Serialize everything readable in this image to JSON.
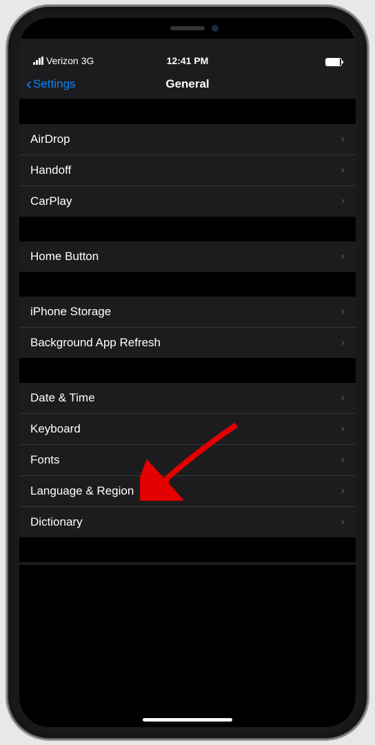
{
  "statusBar": {
    "carrier": "Verizon",
    "network": "3G",
    "time": "12:41 PM"
  },
  "navBar": {
    "backLabel": "Settings",
    "title": "General"
  },
  "groups": [
    {
      "items": [
        {
          "label": "AirDrop"
        },
        {
          "label": "Handoff"
        },
        {
          "label": "CarPlay"
        }
      ]
    },
    {
      "items": [
        {
          "label": "Home Button"
        }
      ]
    },
    {
      "items": [
        {
          "label": "iPhone Storage"
        },
        {
          "label": "Background App Refresh"
        }
      ]
    },
    {
      "items": [
        {
          "label": "Date & Time"
        },
        {
          "label": "Keyboard"
        },
        {
          "label": "Fonts"
        },
        {
          "label": "Language & Region"
        },
        {
          "label": "Dictionary"
        }
      ]
    }
  ],
  "annotation": {
    "target": "Keyboard"
  }
}
